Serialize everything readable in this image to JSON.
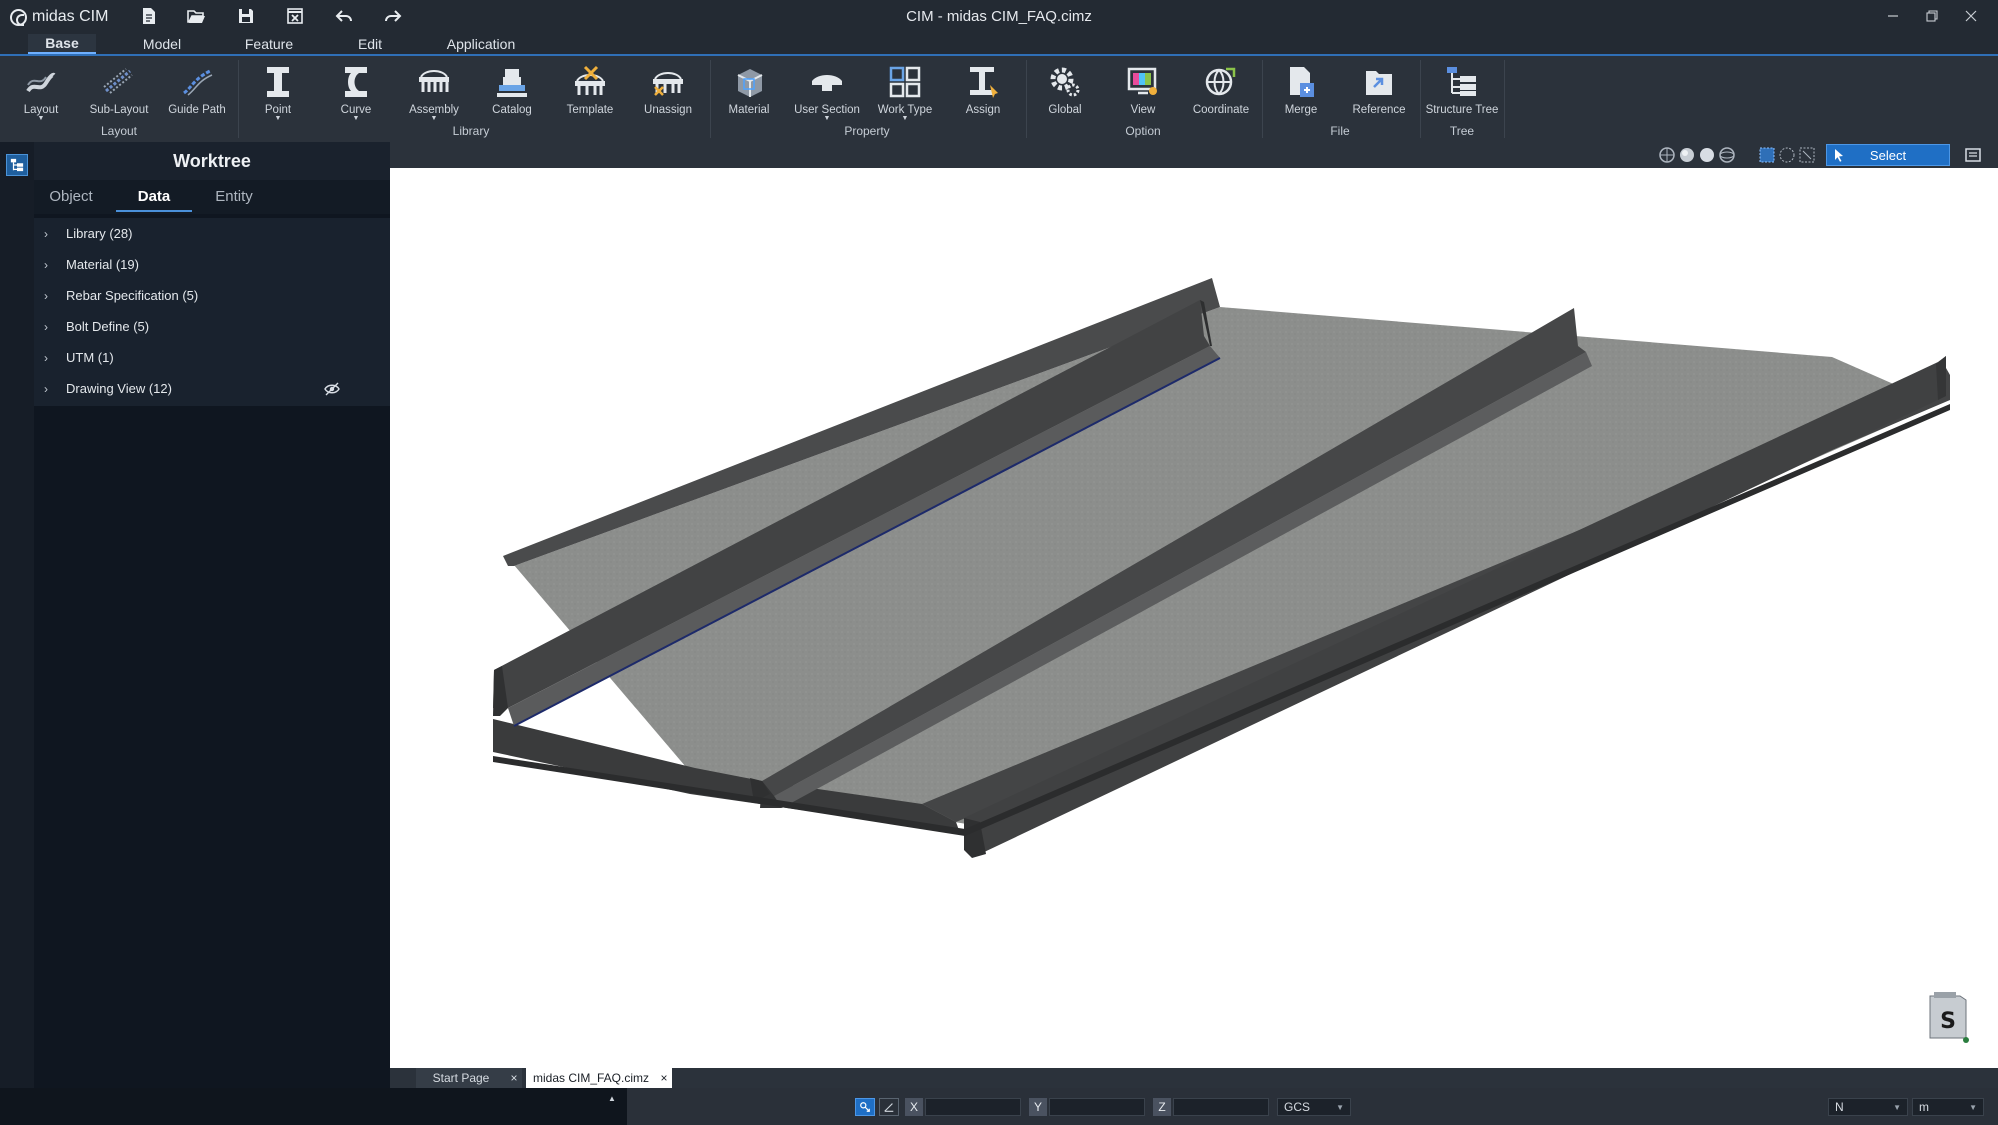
{
  "app": {
    "logo_text": "midas CIM",
    "window_title": "CIM - midas CIM_FAQ.cimz"
  },
  "menu_tabs": [
    "Base",
    "Model",
    "Feature",
    "Edit",
    "Application"
  ],
  "ribbon": {
    "groups": [
      "Layout",
      "Library",
      "Property",
      "Option",
      "File",
      "Tree"
    ],
    "buttons": [
      "Layout",
      "Sub-Layout",
      "Guide Path",
      "Point",
      "Curve",
      "Assembly",
      "Catalog",
      "Template",
      "Unassign",
      "Material",
      "User Section",
      "Work Type",
      "Assign",
      "Global",
      "View",
      "Coordinate",
      "Merge",
      "Reference",
      "Structure Tree"
    ]
  },
  "worktree": {
    "title": "Worktree",
    "tabs": [
      "Object",
      "Data",
      "Entity"
    ],
    "active_tab": "Data",
    "items": [
      "Library (28)",
      "Material (19)",
      "Rebar Specification (5)",
      "Bolt Define (5)",
      "UTM (1)",
      "Drawing View (12)"
    ]
  },
  "viewport": {
    "select_label": "Select"
  },
  "doc_tabs": [
    {
      "label": "Start Page",
      "close": "×"
    },
    {
      "label": "midas CIM_FAQ.cimz",
      "close": "×"
    }
  ],
  "statusbar": {
    "x_label": "X",
    "y_label": "Y",
    "z_label": "Z",
    "coord_system": "GCS",
    "force_unit": "N",
    "length_unit": "m"
  },
  "colors": {
    "accent": "#2f6fb7",
    "select_button": "#1f6fc5",
    "model_deck": "#8c8e8c",
    "model_barrier": "#3d3e3f"
  }
}
